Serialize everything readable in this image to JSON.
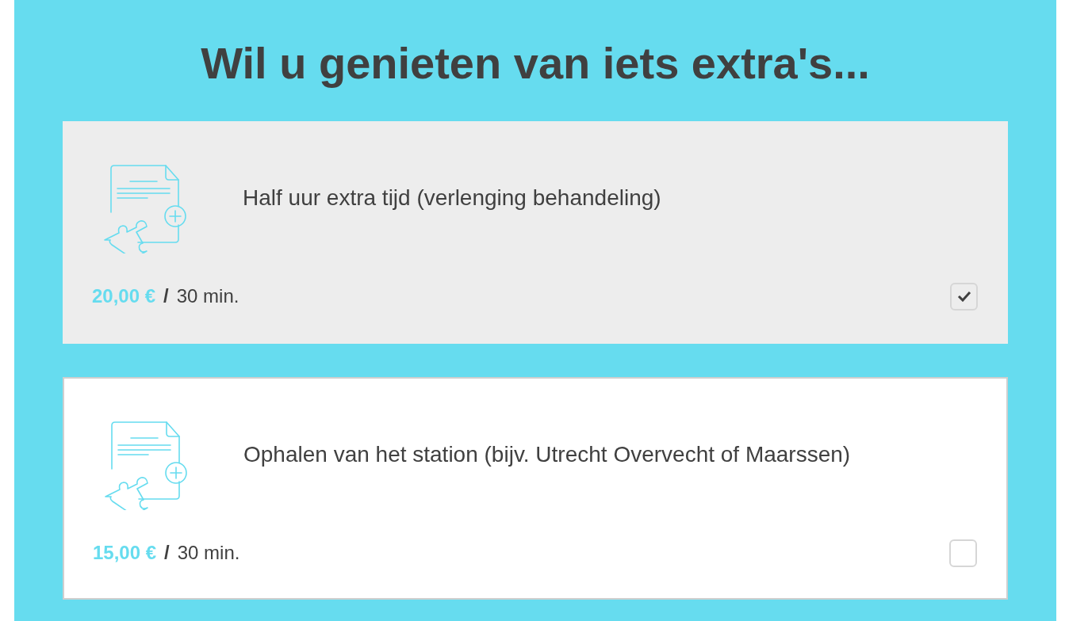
{
  "heading": "Wil u genieten van iets extra's...",
  "extras": [
    {
      "name": "Half uur extra tijd (verlenging behandeling)",
      "price": "20,00 €",
      "separator": "/",
      "duration": "30 min.",
      "checked": true
    },
    {
      "name": "Ophalen van het station (bijv. Utrecht Overvecht of Maarssen)",
      "price": "15,00 €",
      "separator": "/",
      "duration": "30 min.",
      "checked": false
    }
  ]
}
